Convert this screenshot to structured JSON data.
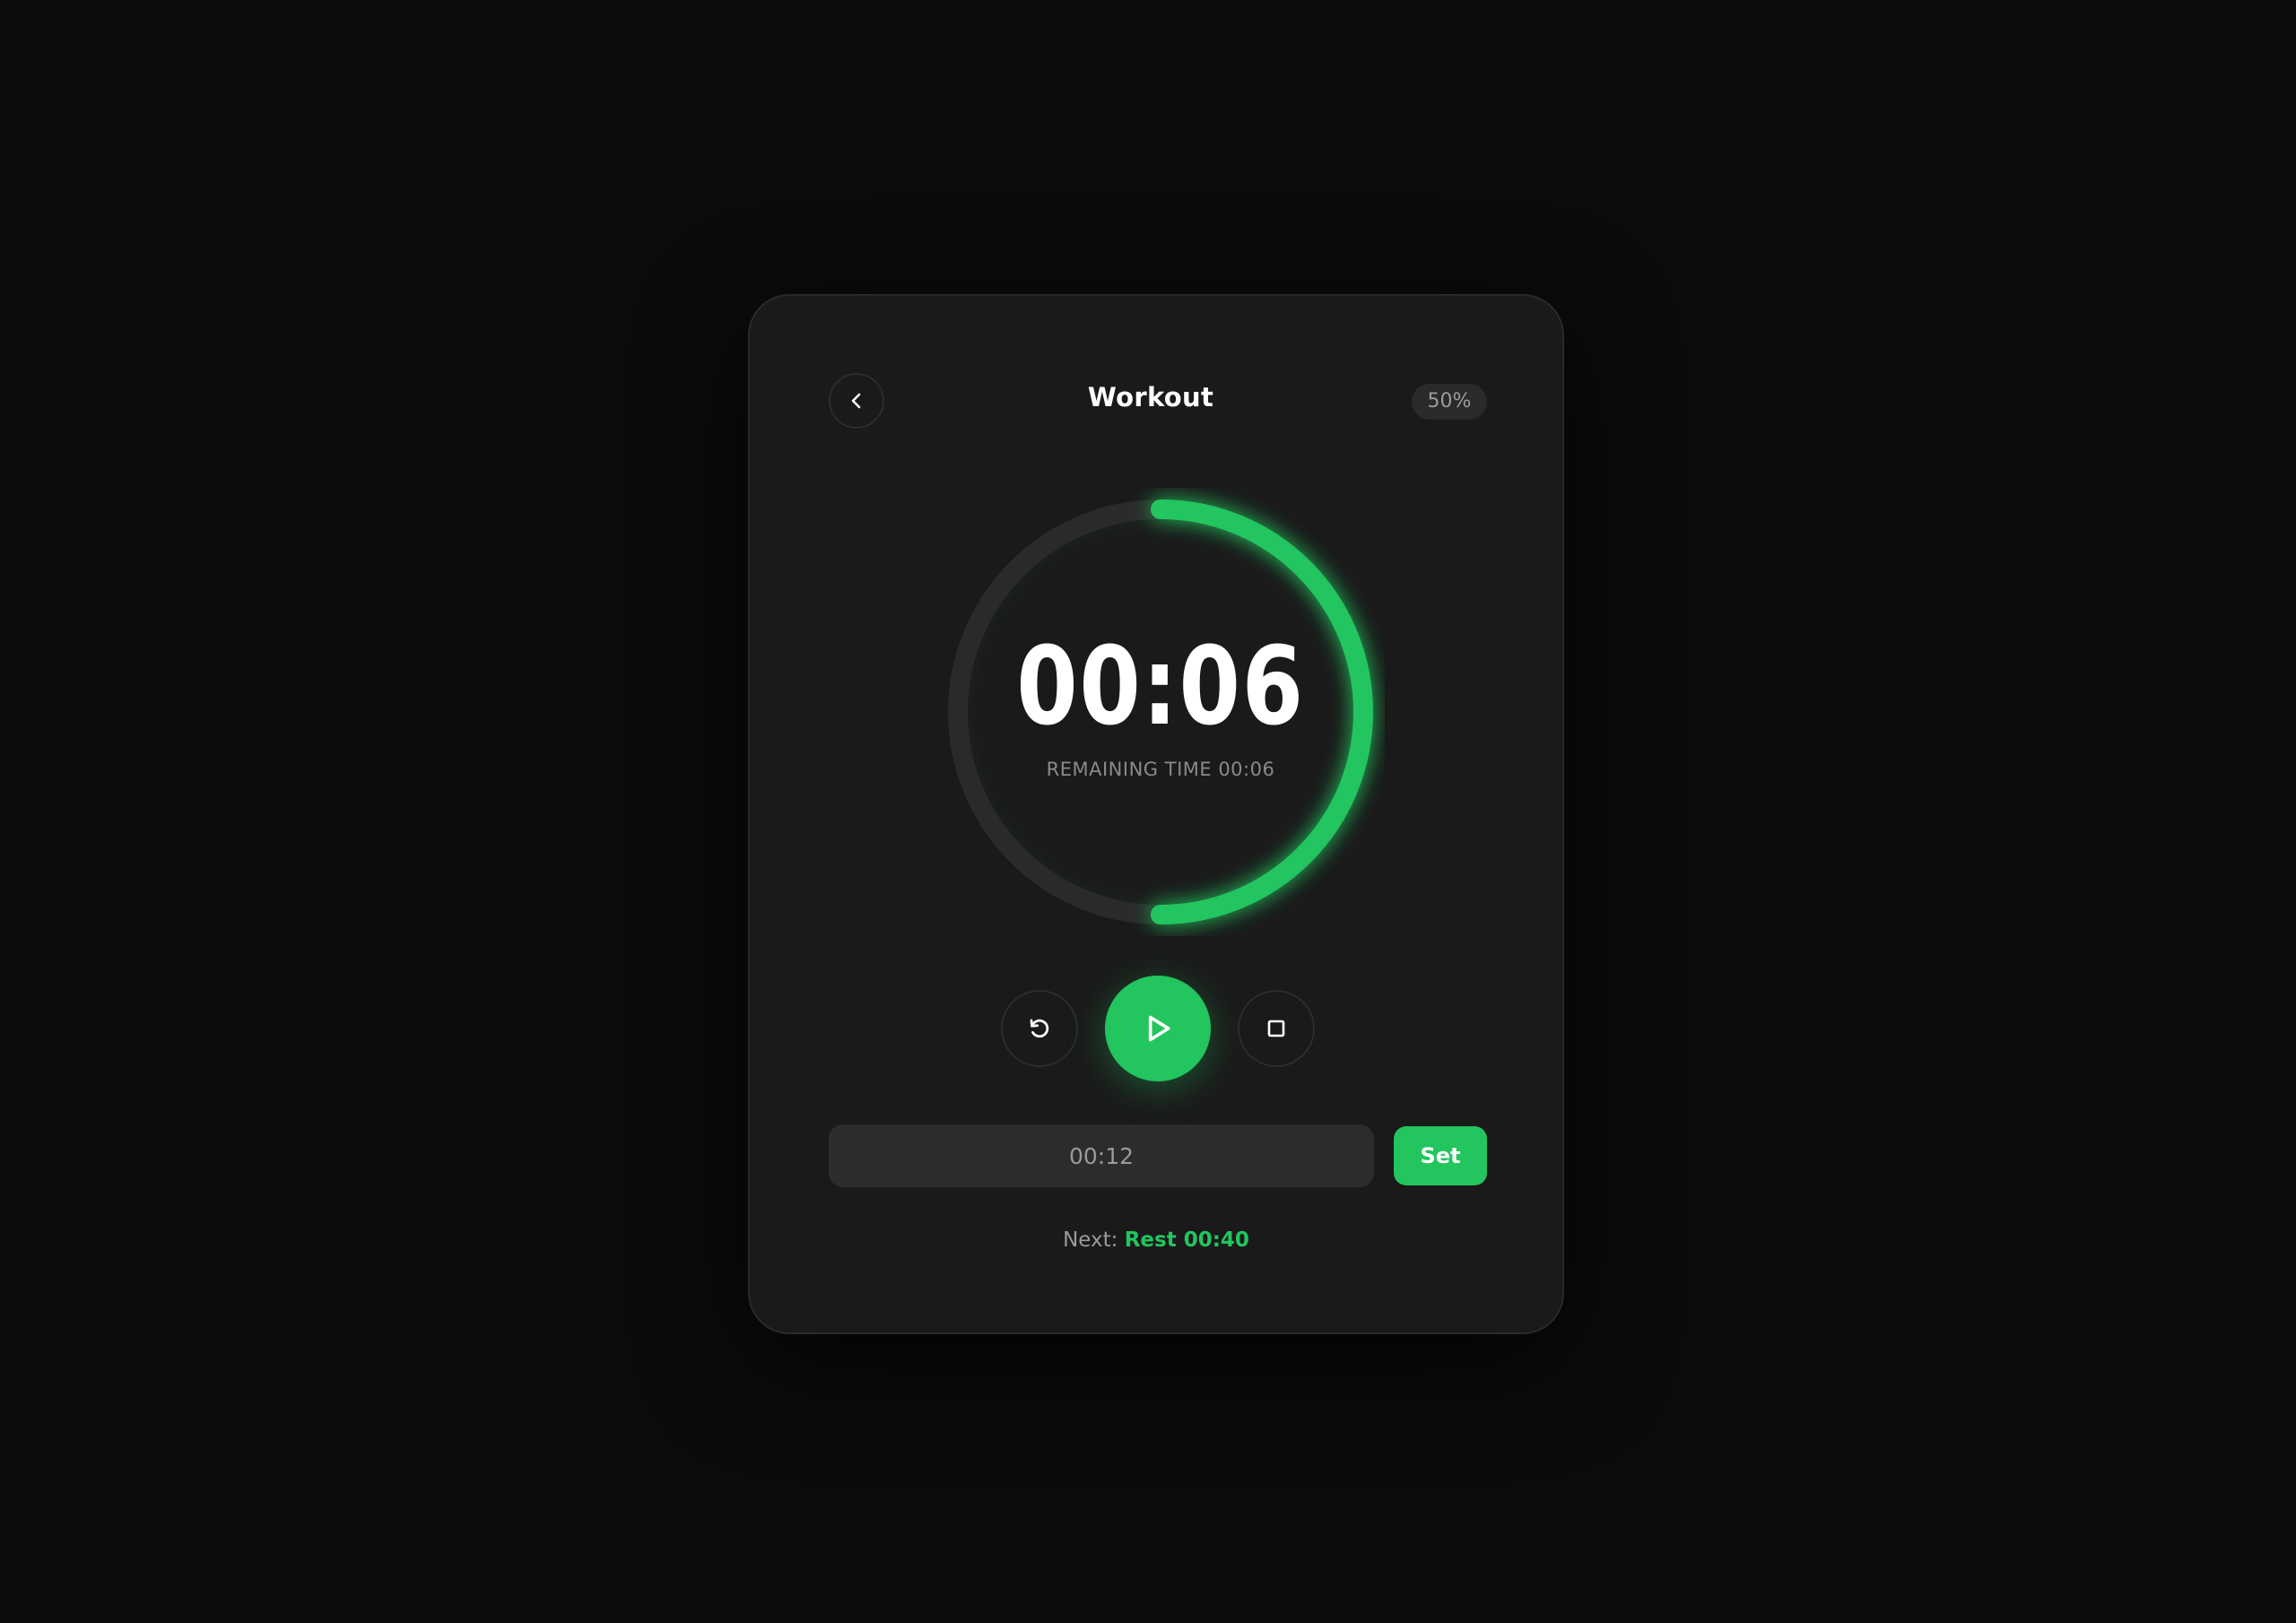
{
  "header": {
    "title": "Workout",
    "progress_badge": "50%",
    "back_icon": "chevron-left-icon"
  },
  "timer": {
    "display": "00:06",
    "subtitle": "REMAINING TIME 00:06",
    "progress_fraction": 0.5,
    "accent_color": "#22c55e",
    "track_color": "#2a2a2a"
  },
  "controls": {
    "reset_icon": "reset-icon",
    "play_icon": "play-icon",
    "stop_icon": "stop-icon"
  },
  "input": {
    "placeholder": "00:12",
    "value": ""
  },
  "set_button": {
    "label": "Set"
  },
  "next": {
    "label": "Next:",
    "value": "Rest 00:40"
  }
}
